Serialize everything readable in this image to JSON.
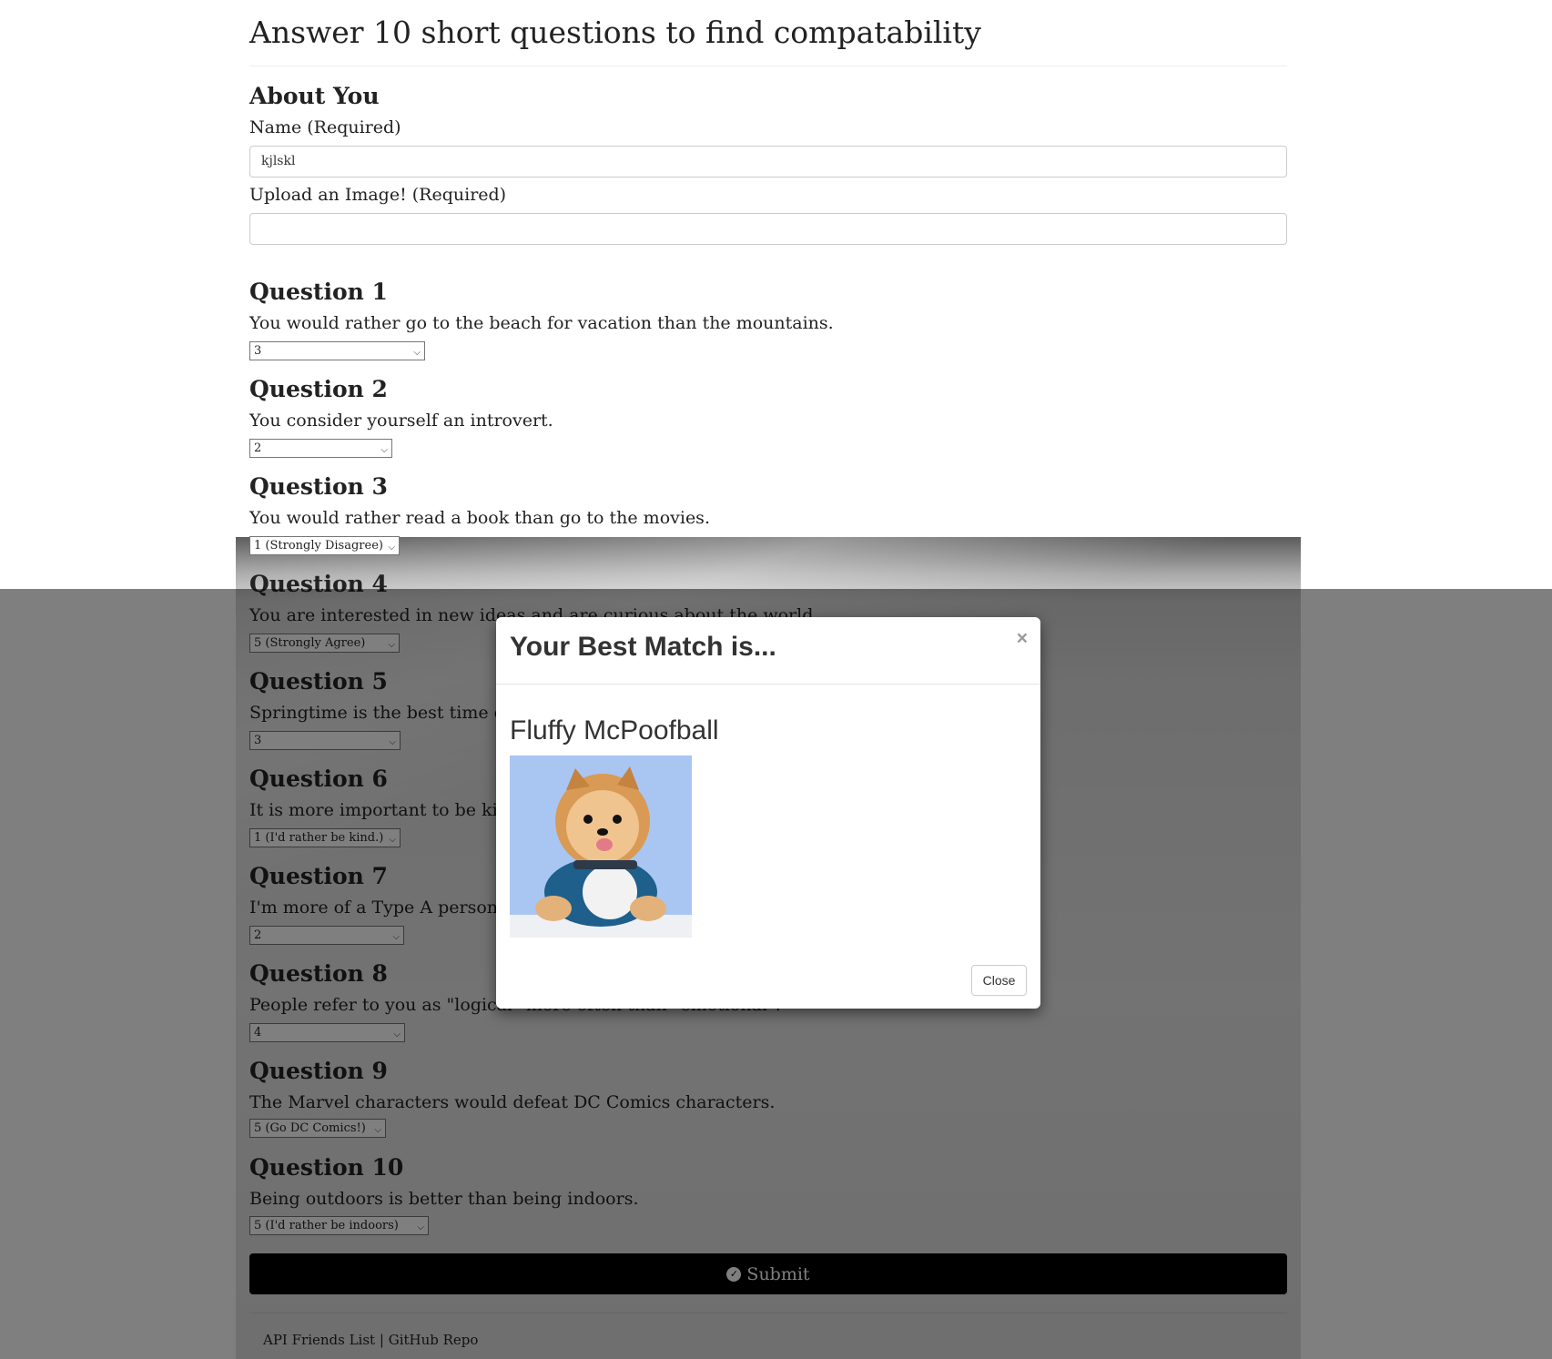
{
  "page": {
    "title": "Answer 10 short questions to find compatability"
  },
  "about": {
    "heading": "About You",
    "name_label": "Name (Required)",
    "name_value": "kjlskl",
    "image_label": "Upload an Image! (Required)",
    "image_value": ""
  },
  "questions": [
    {
      "heading": "Question 1",
      "text": "You would rather go to the beach for vacation than the mountains.",
      "selected": "3"
    },
    {
      "heading": "Question 2",
      "text": "You consider yourself an introvert.",
      "selected": "2"
    },
    {
      "heading": "Question 3",
      "text": "You would rather read a book than go to the movies.",
      "selected": "1 (Strongly Disagree)"
    },
    {
      "heading": "Question 4",
      "text": "You are interested in new ideas and are curious about the world.",
      "selected": "5 (Strongly Agree)"
    },
    {
      "heading": "Question 5",
      "text": "Springtime is the best time of the year.",
      "selected": "3"
    },
    {
      "heading": "Question 6",
      "text": "It is more important to be kind than right.",
      "selected": "1 (I'd rather be kind.)"
    },
    {
      "heading": "Question 7",
      "text": "I'm more of a Type A personality.",
      "selected": "2"
    },
    {
      "heading": "Question 8",
      "text": "People refer to you as \"logical\" more often than \"emotional\".",
      "selected": "4"
    },
    {
      "heading": "Question 9",
      "text": "The Marvel characters would defeat DC Comics characters.",
      "selected": "5 (Go DC Comics!)"
    },
    {
      "heading": "Question 10",
      "text": "Being outdoors is better than being indoors.",
      "selected": "5 (I'd rather be indoors)"
    }
  ],
  "submit": {
    "label": "Submit",
    "icon": "check-circle-icon"
  },
  "footer": {
    "api_link": "API Friends List",
    "separator": "|",
    "github_link": "GitHub Repo"
  },
  "modal": {
    "title": "Your Best Match is...",
    "close_x": "×",
    "match_name": "Fluffy McPoofball",
    "close_button": "Close"
  }
}
